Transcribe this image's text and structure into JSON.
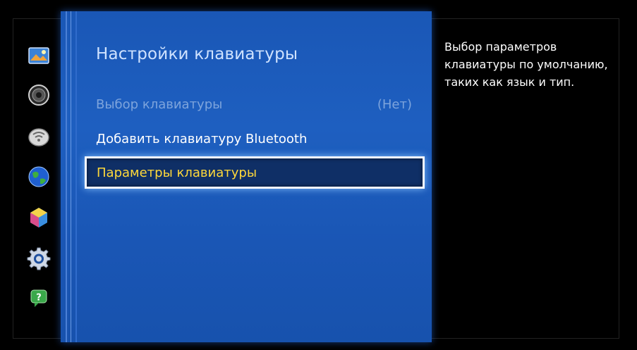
{
  "panel": {
    "title": "Настройки клавиатуры"
  },
  "menu": {
    "items": [
      {
        "label": "Выбор клавиатуры",
        "value": "(Нет)",
        "state": "disabled"
      },
      {
        "label": "Добавить клавиатуру Bluetooth",
        "state": "normal"
      },
      {
        "label": "Параметры клавиатуры",
        "state": "selected"
      }
    ]
  },
  "help": {
    "text": "Выбор параметров клавиатуры по умолчанию, таких как язык и тип."
  },
  "nav_icons": [
    "picture-icon",
    "sound-icon",
    "network-icon",
    "smart-hub-icon",
    "system-icon",
    "settings-gear-icon",
    "support-icon"
  ],
  "colors": {
    "panel_blue": "#1a57b6",
    "selected_text": "#ffd83a",
    "selected_bg": "#0f2f66",
    "disabled_text": "#7da4dc"
  }
}
